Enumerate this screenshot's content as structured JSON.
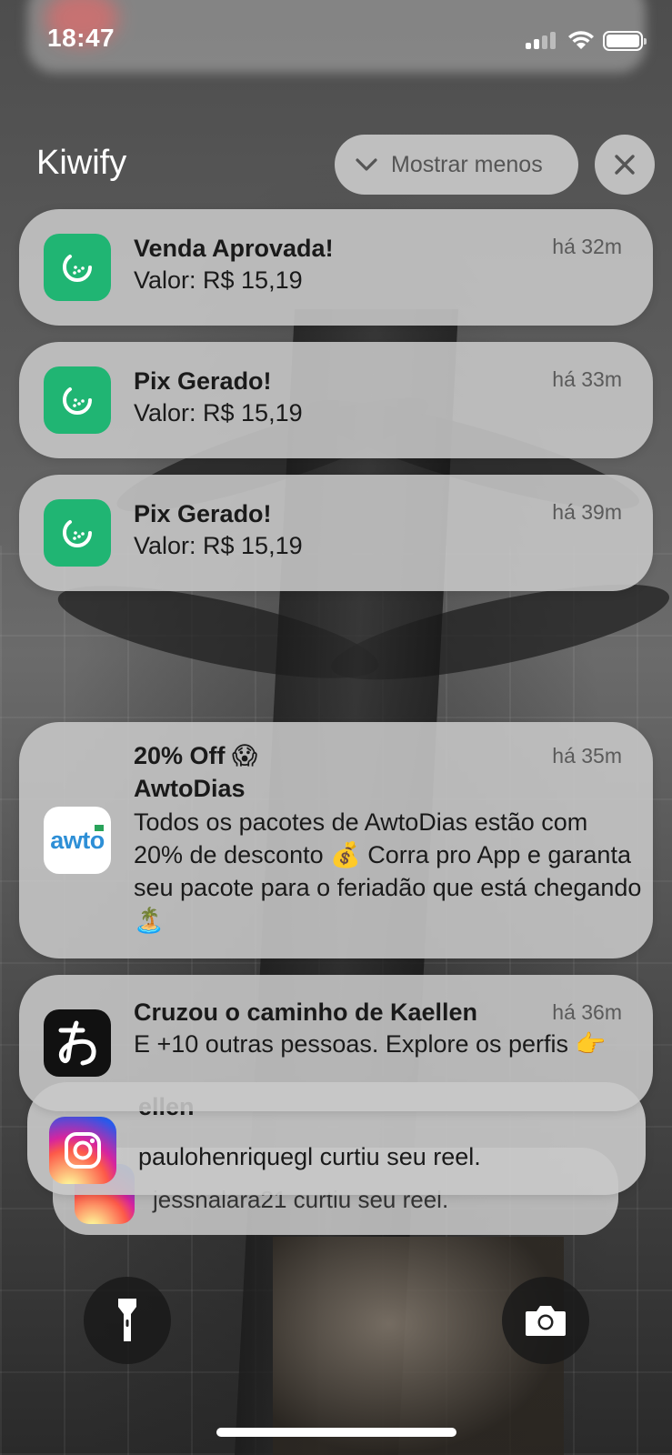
{
  "status_bar": {
    "time": "18:47"
  },
  "group": {
    "app_name": "Kiwify",
    "show_less_label": "Mostrar menos"
  },
  "notifications": [
    {
      "app": "Kiwify",
      "icon": "kiwify-icon",
      "title": "Venda Aprovada!",
      "body": "Valor: R$ 15,19",
      "time": "há 32m"
    },
    {
      "app": "Kiwify",
      "icon": "kiwify-icon",
      "title": "Pix Gerado!",
      "body": "Valor: R$ 15,19",
      "time": "há 33m"
    },
    {
      "app": "Kiwify",
      "icon": "kiwify-icon",
      "title": "Pix Gerado!",
      "body": "Valor: R$ 15,19",
      "time": "há 39m"
    },
    {
      "app": "AwtoDias",
      "icon": "awto-icon",
      "icon_text": "awto",
      "title": "20% Off 😱",
      "subtitle": "AwtoDias",
      "body": "Todos os pacotes de AwtoDias estão com 20% de desconto 💰 Corra pro App e garanta seu pacote para o feriadão que está chegando🏝️",
      "time": "há 35m"
    },
    {
      "app": "happn",
      "icon": "happn-icon",
      "title": "Cruzou o caminho de Kaellen",
      "body": "E +10 outras pessoas. Explore os perfis 👉",
      "time": "há 36m"
    },
    {
      "app": "Instagram",
      "icon": "instagram-icon",
      "title": "ellen",
      "body": "paulohenriquegl curtiu seu reel."
    },
    {
      "app": "Instagram",
      "icon": "instagram-icon",
      "body": "jessnalara21 curtiu seu reel."
    }
  ],
  "colors": {
    "kiwify_green": "#20b573",
    "awto_blue": "#2e8fd6",
    "card_bg": "#c8c8c8"
  }
}
